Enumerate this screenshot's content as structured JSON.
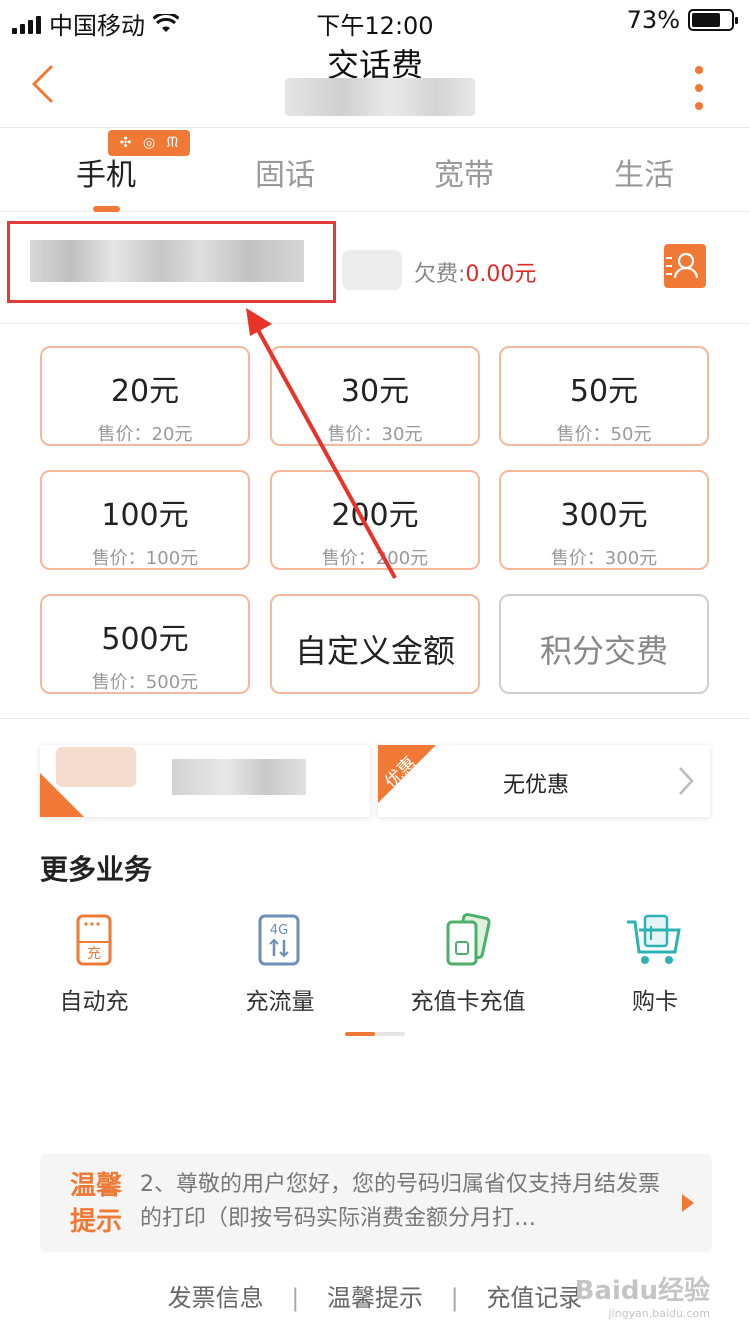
{
  "status_bar": {
    "carrier": "中国移动",
    "time": "下午12:00",
    "battery": "73%",
    "battery_level": 0.73
  },
  "nav": {
    "title": "交话费"
  },
  "tabs": [
    {
      "label": "手机",
      "active": true
    },
    {
      "label": "固话",
      "active": false
    },
    {
      "label": "宽带",
      "active": false
    },
    {
      "label": "生活",
      "active": false
    }
  ],
  "account": {
    "owed_label": "欠费:",
    "owed_amount": "0.00元"
  },
  "amounts": [
    {
      "main": "20元",
      "price": "售价：20元"
    },
    {
      "main": "30元",
      "price": "售价：30元"
    },
    {
      "main": "50元",
      "price": "售价：50元"
    },
    {
      "main": "100元",
      "price": "售价：100元"
    },
    {
      "main": "200元",
      "price": "售价：200元"
    },
    {
      "main": "300元",
      "price": "售价：300元"
    },
    {
      "main": "500元",
      "price": "售价：500元"
    }
  ],
  "custom_amount": "自定义金额",
  "points_pay": "积分交费",
  "promo": {
    "tag": "优惠",
    "label": "无优惠"
  },
  "more_services": {
    "title": "更多业务",
    "items": [
      {
        "label": "自动充",
        "icon": "auto-recharge-icon",
        "badge": "充"
      },
      {
        "label": "充流量",
        "icon": "data-recharge-icon",
        "badge": "4G"
      },
      {
        "label": "充值卡充值",
        "icon": "recharge-card-icon"
      },
      {
        "label": "购卡",
        "icon": "shopping-cart-icon"
      }
    ]
  },
  "tips": {
    "title": "温馨提示",
    "text": "2、尊敬的用户您好，您的号码归属省仅支持月结发票的打印（即按号码实际消费金额分月打…"
  },
  "footer": {
    "links": [
      "发票信息",
      "温馨提示",
      "充值记录"
    ]
  },
  "watermark": {
    "brand": "Baidu经验",
    "url": "jingyan.baidu.com"
  },
  "colors": {
    "accent": "#f07a35",
    "alert": "#e02a2a",
    "highlight_box": "#e03a3a"
  }
}
